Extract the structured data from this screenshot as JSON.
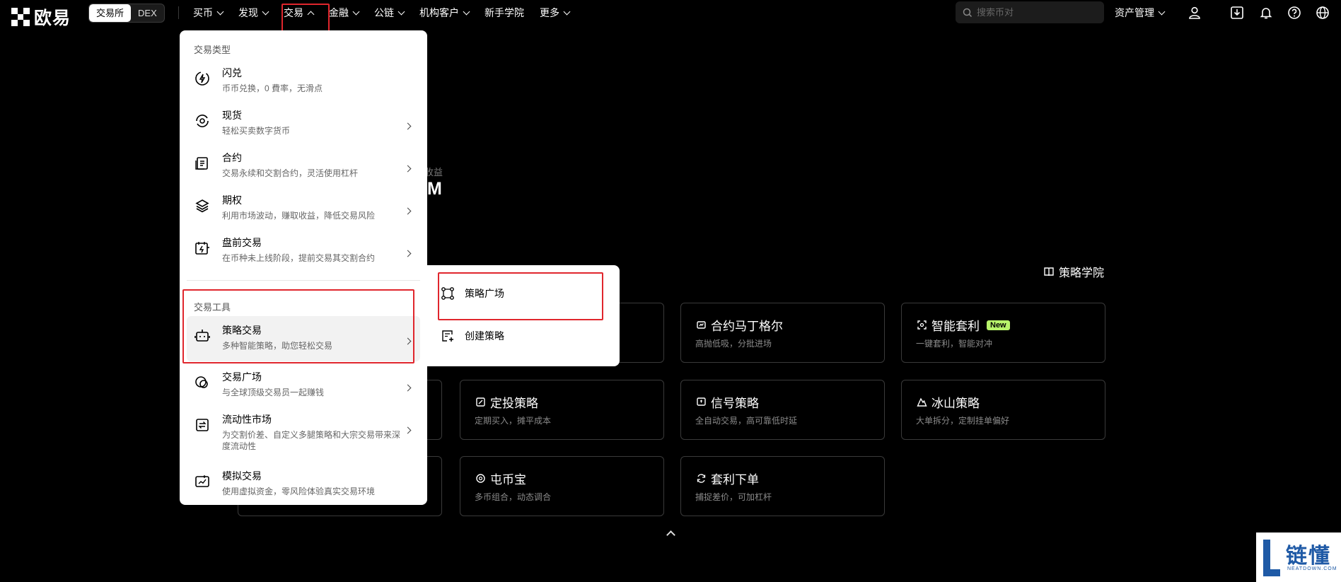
{
  "brand": {
    "name": "欧易"
  },
  "mode_switch": {
    "exchange": "交易所",
    "dex": "DEX"
  },
  "nav": {
    "buy": "买币",
    "discover": "发现",
    "trade": "交易",
    "finance": "金融",
    "chain": "公链",
    "institution": "机构客户",
    "academy": "新手学院",
    "more": "更多"
  },
  "search": {
    "placeholder": "搜索币对"
  },
  "assets": {
    "label": "资产管理"
  },
  "trade_menu": {
    "section_types": "交易类型",
    "section_tools": "交易工具",
    "items": [
      {
        "title": "闪兑",
        "desc": "币币兑换，0 費率，无滑点"
      },
      {
        "title": "现货",
        "desc": "轻松买卖数字货币"
      },
      {
        "title": "合约",
        "desc": "交易永续和交割合约，灵活使用杠杆"
      },
      {
        "title": "期权",
        "desc": "利用市场波动，赚取收益，降低交易风险"
      },
      {
        "title": "盘前交易",
        "desc": "在币种未上线阶段，提前交易其交割合约"
      },
      {
        "title": "策略交易",
        "desc": "多种智能策略，助您轻松交易"
      },
      {
        "title": "交易广场",
        "desc": "与全球顶级交易员一起赚钱"
      },
      {
        "title": "流动性市场",
        "desc": "为交割价差、自定义多腿策略和大宗交易带来深度流动性"
      },
      {
        "title": "模拟交易",
        "desc": "使用虚拟资金，零风险体验真实交易环境"
      }
    ]
  },
  "strategy_submenu": {
    "square": "策略广场",
    "create": "创建策略"
  },
  "page": {
    "partial_small": "收益",
    "partial_big": "M",
    "academy_link": "策略学院",
    "cards": [
      {
        "title": "合约马丁格尔",
        "desc": "高抛低吸，分批进场"
      },
      {
        "title": "智能套利",
        "desc": "一键套利，智能对冲",
        "badge": "New"
      },
      {
        "title": "定投策略",
        "desc": "定期买入，摊平成本"
      },
      {
        "title": "信号策略",
        "desc": "全自动交易，高可靠低时延"
      },
      {
        "title": "冰山策略",
        "desc": "大单拆分，定制挂单偏好"
      },
      {
        "title": "屯币宝",
        "desc": "多币组合，动态调合"
      },
      {
        "title": "套利下单",
        "desc": "捕捉差价，可加杠杆"
      }
    ]
  },
  "watermark": {
    "title": "链懂",
    "subtitle": "NEATDOWN.COM"
  },
  "colors": {
    "highlight_box": "#e0262d",
    "new_badge": "#b8f36b",
    "watermark": "#1f5aa6"
  }
}
